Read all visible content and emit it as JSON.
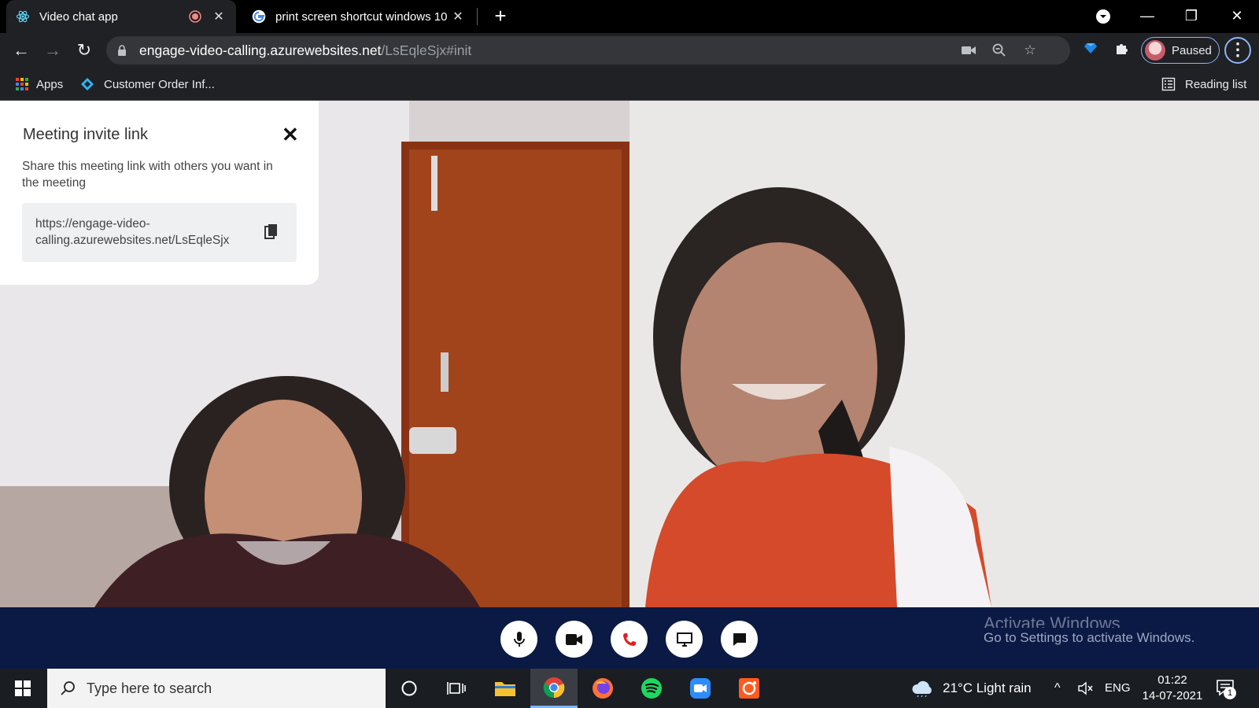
{
  "tabs": [
    {
      "title": "Video chat app",
      "active": true,
      "icon": "react-icon"
    },
    {
      "title": "print screen shortcut windows 10",
      "active": false,
      "icon": "google-icon"
    }
  ],
  "toolbar": {
    "url_host": "engage-video-calling.azurewebsites.net",
    "url_path": "/LsEqleSjx#init",
    "profile_label": "Paused"
  },
  "bookmarks": {
    "apps": "Apps",
    "customer_order": "Customer Order Inf...",
    "reading_list": "Reading list"
  },
  "invite": {
    "title": "Meeting invite link",
    "description": "Share this meeting link with others you want in the meeting",
    "link": "https://engage-video-calling.azurewebsites.net/LsEqleSjx"
  },
  "controls": [
    "microphone-icon",
    "video-camera-icon",
    "end-call-icon",
    "screen-share-icon",
    "chat-icon"
  ],
  "watermark": {
    "line1": "Activate Windows",
    "line2": "Go to Settings to activate Windows."
  },
  "taskbar": {
    "search_placeholder": "Type here to search",
    "weather": "21°C  Light rain",
    "language": "ENG",
    "time": "01:22",
    "date": "14-07-2021",
    "notification_count": "1"
  },
  "colors": {
    "meeting_background": "#0b1a44",
    "end_call_red": "#e02020",
    "chrome_dark": "#202124"
  }
}
